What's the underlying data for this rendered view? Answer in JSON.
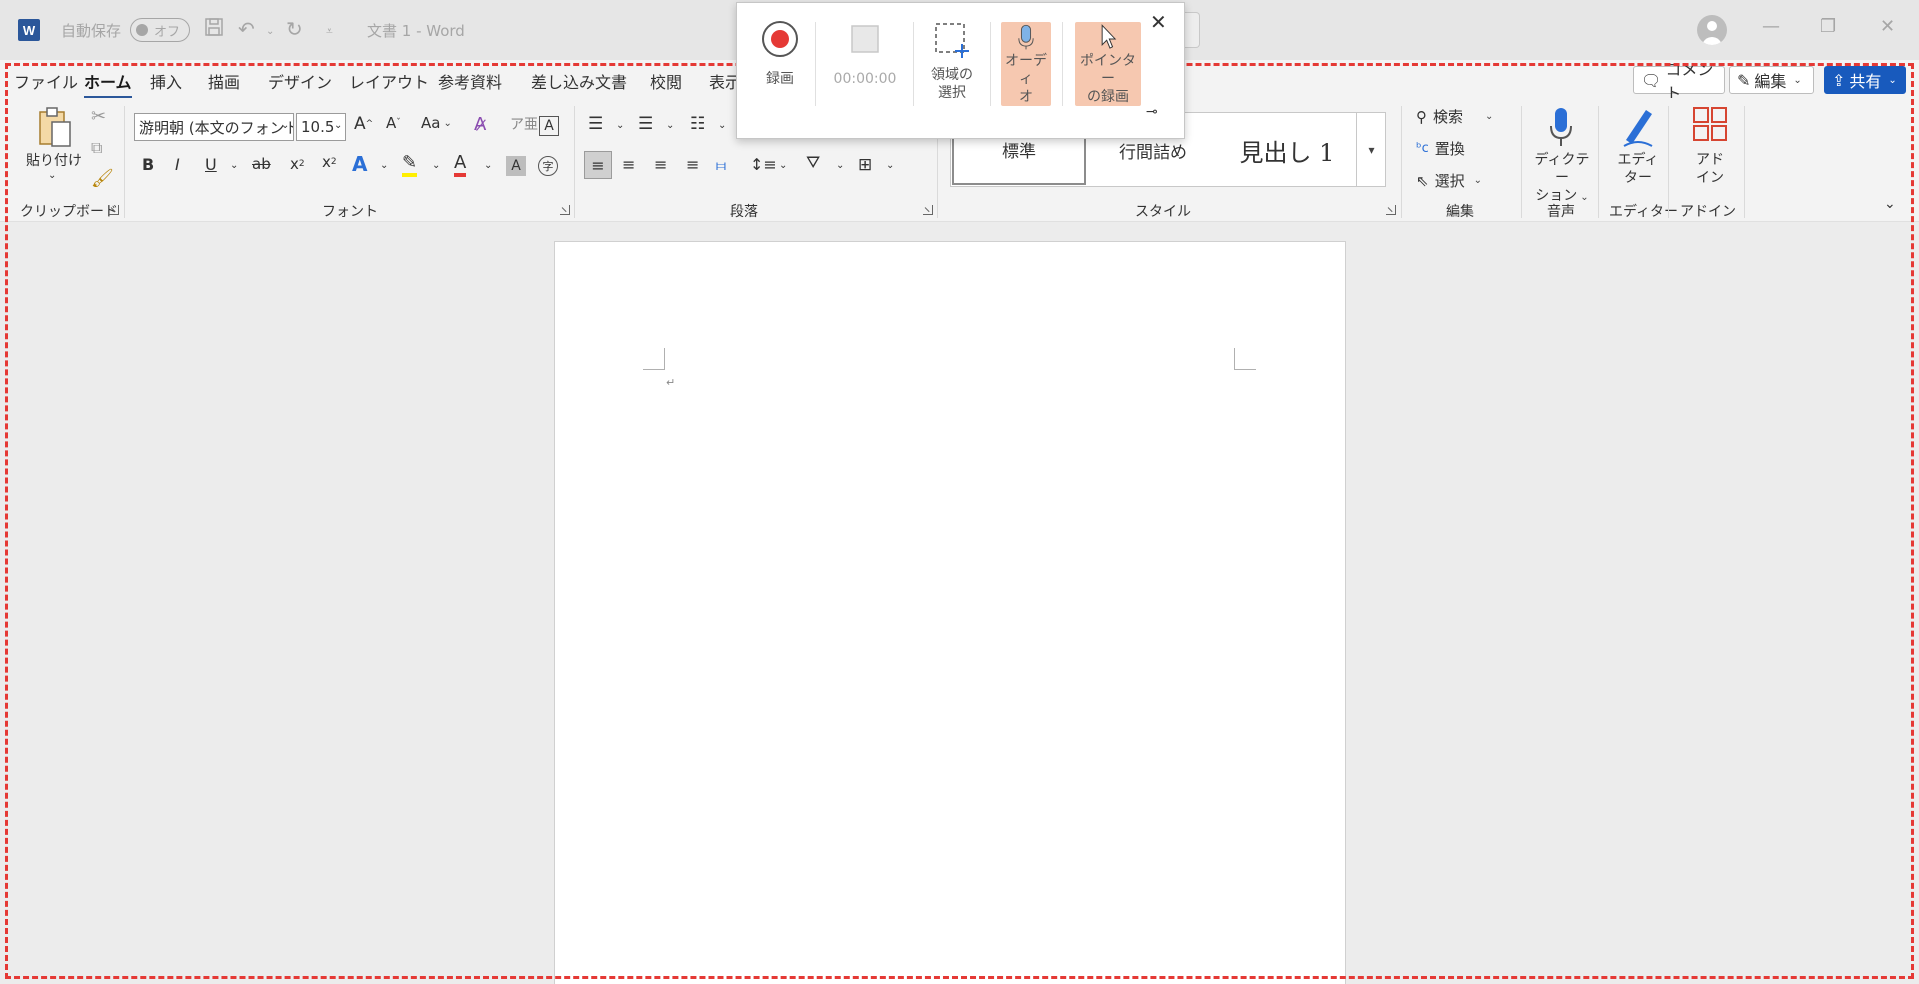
{
  "app": {
    "logo": "W",
    "autosave_label": "自動保存",
    "autosave_state": "オフ",
    "doc_title": "文書 1  -  Word"
  },
  "tabs": [
    "ファイル",
    "ホーム",
    "挿入",
    "描画",
    "デザイン",
    "レイアウト",
    "参考資料",
    "差し込み文書",
    "校閲",
    "表示"
  ],
  "active_tab": "ホーム",
  "right_buttons": {
    "comment": "コメント",
    "edit": "編集",
    "share": "共有"
  },
  "clipboard": {
    "paste_label": "貼り付け",
    "group_label": "クリップボード"
  },
  "font": {
    "font_name": "游明朝 (本文のフォント",
    "font_size": "10.5",
    "change_case": "Aa",
    "group_label": "フォント"
  },
  "paragraph": {
    "group_label": "段落"
  },
  "styles": {
    "items": [
      "標準",
      "行間詰め",
      "見出し 1"
    ],
    "group_label": "スタイル"
  },
  "editing": {
    "find": "検索",
    "replace": "置換",
    "select": "選択",
    "group_label": "編集"
  },
  "voice": {
    "dictate_line1": "ディクテー",
    "dictate_line2": "ション",
    "group_label": "音声"
  },
  "editor": {
    "line1": "エディ",
    "line2": "ター",
    "group_label": "エディター"
  },
  "addins": {
    "line1": "アド",
    "line2": "イン",
    "group_label": "アドイン"
  },
  "recorder": {
    "record_label": "録画",
    "timer": "00:00:00",
    "region_line1": "領域の",
    "region_line2": "選択",
    "audio_line1": "オーディ",
    "audio_line2": "オ",
    "pointer_line1": "ポインター",
    "pointer_line2": "の録画"
  },
  "colors": {
    "accent": "#2b579a",
    "share": "#185abd",
    "selection_border": "#e53935",
    "record_red": "#e53935",
    "toggle_highlight": "#f6c8b0"
  }
}
